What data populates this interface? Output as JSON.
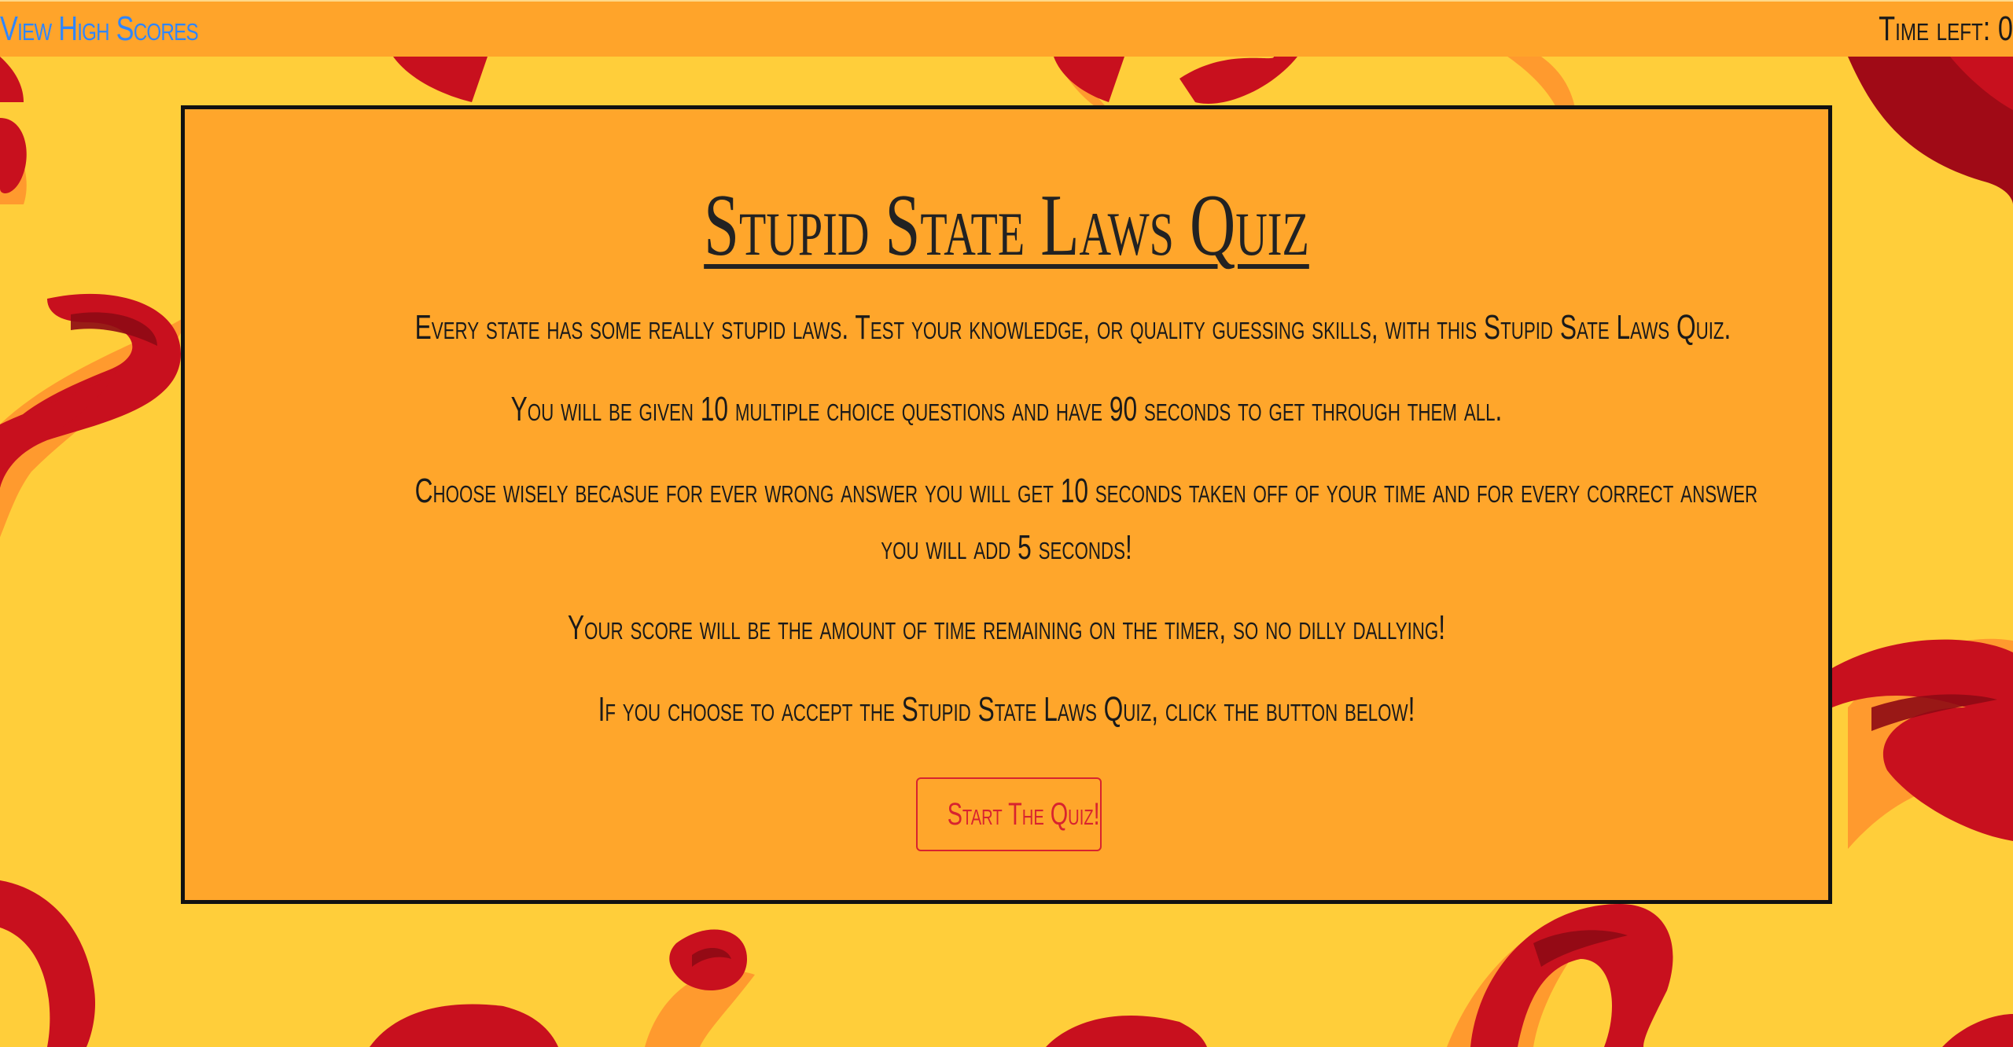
{
  "header": {
    "high_scores_link": "View High Scores",
    "timer_label": "Time left: 0"
  },
  "quiz": {
    "title": "Stupid State Laws Quiz",
    "intro_1": "Every state has some really stupid laws. Test your knowledge, or quality guessing skills, with this Stupid Sate Laws Quiz.",
    "intro_2": "You will be given 10 multiple choice questions and have 90 seconds to get through them all.",
    "intro_3a": "Choose wisely becasue for ever wrong answer you will get 10 seconds taken off of your time and for every correct answer",
    "intro_3b": "you will add 5 seconds!",
    "intro_4": "Your score will be the amount of time remaining on the timer, so no dilly dallying!",
    "intro_5": "If you choose to accept the Stupid State Laws Quiz, click the button below!",
    "start_button": "Start The Quiz!"
  },
  "colors": {
    "page_background": "#FFCE3A",
    "topbar_background": "#FFA42A",
    "card_background": "#FFA62B",
    "link": "#2f86ff",
    "button_accent": "#d8232f",
    "swirl_red": "#c8101e",
    "swirl_dark_red": "#8e0a14",
    "swirl_orange": "#ff9a2e"
  }
}
